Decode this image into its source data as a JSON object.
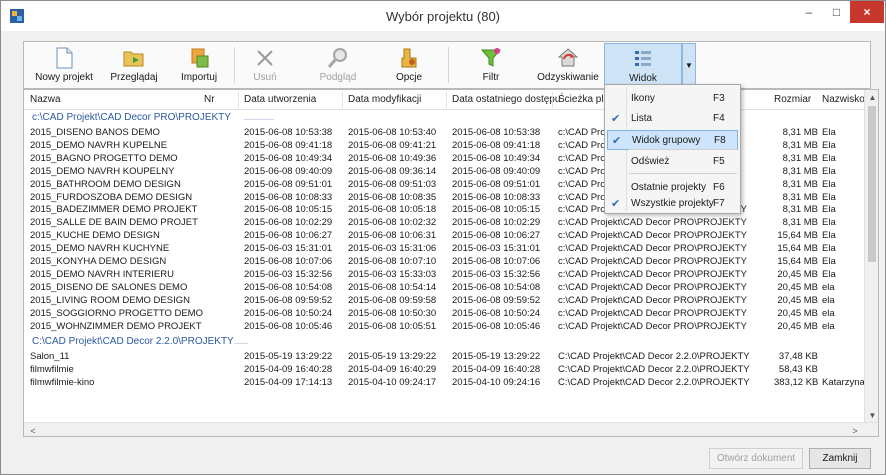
{
  "window": {
    "title": "Wybór projektu (80)",
    "minimize": "–",
    "maximize": "□",
    "close": "×"
  },
  "toolbar": {
    "buttons": [
      {
        "label": "Nowy projekt",
        "icon": "new-document-icon"
      },
      {
        "label": "Przeglądaj",
        "icon": "open-folder-icon"
      },
      {
        "label": "Importuj",
        "icon": "import-icon"
      },
      {
        "label": "Usuń",
        "icon": "delete-icon",
        "disabled": true
      },
      {
        "label": "Podgląd",
        "icon": "preview-icon",
        "disabled": true
      },
      {
        "label": "Opcje",
        "icon": "options-icon"
      },
      {
        "label": "Filtr",
        "icon": "filter-icon"
      },
      {
        "label": "Odzyskiwanie",
        "icon": "recovery-icon"
      },
      {
        "label": "Widok",
        "icon": "view-icon"
      }
    ],
    "dropdown_arrow": "▼"
  },
  "columns": {
    "name": "Nazwa",
    "nr": "Nr",
    "created": "Data utworzenia",
    "modified": "Data modyfikacji",
    "accessed": "Data ostatniego dostępu",
    "path": "Ścieżka pli",
    "size": "Rozmiar",
    "surname": "Nazwisko"
  },
  "groups": [
    {
      "header": "c:\\CAD Projekt\\CAD Decor PRO\\PROJEKTY",
      "rows": [
        {
          "name": "2015_DISENO BANOS DEMO",
          "created": "2015-06-08 10:53:38",
          "modified": "2015-06-08 10:53:40",
          "accessed": "2015-06-08 10:53:38",
          "path": "c:\\CAD Pro",
          "size": "8,31 MB",
          "surname": "Ela"
        },
        {
          "name": "2015_DEMO NAVRH KUPELNE",
          "created": "2015-06-08 09:41:18",
          "modified": "2015-06-08 09:41:21",
          "accessed": "2015-06-08 09:41:18",
          "path": "c:\\CAD Pro",
          "size": "8,31 MB",
          "surname": "Ela"
        },
        {
          "name": "2015_BAGNO PROGETTO DEMO",
          "created": "2015-06-08 10:49:34",
          "modified": "2015-06-08 10:49:36",
          "accessed": "2015-06-08 10:49:34",
          "path": "c:\\CAD Pro",
          "size": "8,31 MB",
          "surname": "Ela"
        },
        {
          "name": "2015_DEMO NAVRH KOUPELNY",
          "created": "2015-06-08 09:40:09",
          "modified": "2015-06-08 09:36:14",
          "accessed": "2015-06-08 09:40:09",
          "path": "c:\\CAD Pro",
          "size": "8,31 MB",
          "surname": "Ela"
        },
        {
          "name": "2015_BATHROOM DEMO DESIGN",
          "created": "2015-06-08 09:51:01",
          "modified": "2015-06-08 09:51:03",
          "accessed": "2015-06-08 09:51:01",
          "path": "c:\\CAD Pro",
          "size": "8,31 MB",
          "surname": "Ela"
        },
        {
          "name": "2015_FURDOSZOBA DEMO DESIGN",
          "created": "2015-06-08 10:08:33",
          "modified": "2015-06-08 10:08:35",
          "accessed": "2015-06-08 10:08:33",
          "path": "c:\\CAD Pro",
          "size": "8,31 MB",
          "surname": "Ela"
        },
        {
          "name": "2015_BADEZIMMER DEMO PROJEKT",
          "created": "2015-06-08 10:05:15",
          "modified": "2015-06-08 10:05:18",
          "accessed": "2015-06-08 10:05:15",
          "path": "c:\\CAD Projekt\\CAD Decor PRO\\PROJEKTY",
          "size": "8,31 MB",
          "surname": "Ela"
        },
        {
          "name": "2015_SALLE DE BAIN DEMO PROJET",
          "created": "2015-06-08 10:02:29",
          "modified": "2015-06-08 10:02:32",
          "accessed": "2015-06-08 10:02:29",
          "path": "c:\\CAD Projekt\\CAD Decor PRO\\PROJEKTY",
          "size": "8,31 MB",
          "surname": "Ela"
        },
        {
          "name": "2015_KUCHE DEMO DESIGN",
          "created": "2015-06-08 10:06:27",
          "modified": "2015-06-08 10:06:31",
          "accessed": "2015-06-08 10:06:27",
          "path": "c:\\CAD Projekt\\CAD Decor PRO\\PROJEKTY",
          "size": "15,64 MB",
          "surname": "Ela"
        },
        {
          "name": "2015_DEMO NAVRH KUCHYNE",
          "created": "2015-06-03 15:31:01",
          "modified": "2015-06-03 15:31:06",
          "accessed": "2015-06-03 15:31:01",
          "path": "c:\\CAD Projekt\\CAD Decor PRO\\PROJEKTY",
          "size": "15,64 MB",
          "surname": "Ela"
        },
        {
          "name": "2015_KONYHA DEMO DESIGN",
          "created": "2015-06-08 10:07:06",
          "modified": "2015-06-08 10:07:10",
          "accessed": "2015-06-08 10:07:06",
          "path": "c:\\CAD Projekt\\CAD Decor PRO\\PROJEKTY",
          "size": "15,64 MB",
          "surname": "Ela"
        },
        {
          "name": "2015_DEMO NAVRH INTERIERU",
          "created": "2015-06-03 15:32:56",
          "modified": "2015-06-03 15:33:03",
          "accessed": "2015-06-03 15:32:56",
          "path": "c:\\CAD Projekt\\CAD Decor PRO\\PROJEKTY",
          "size": "20,45 MB",
          "surname": "Ela"
        },
        {
          "name": "2015_DISENO DE SALONES DEMO",
          "created": "2015-06-08 10:54:08",
          "modified": "2015-06-08 10:54:14",
          "accessed": "2015-06-08 10:54:08",
          "path": "c:\\CAD Projekt\\CAD Decor PRO\\PROJEKTY",
          "size": "20,45 MB",
          "surname": "ela"
        },
        {
          "name": "2015_LIVING ROOM DEMO DESIGN",
          "created": "2015-06-08 09:59:52",
          "modified": "2015-06-08 09:59:58",
          "accessed": "2015-06-08 09:59:52",
          "path": "c:\\CAD Projekt\\CAD Decor PRO\\PROJEKTY",
          "size": "20,45 MB",
          "surname": "ela"
        },
        {
          "name": "2015_SOGGIORNO PROGETTO DEMO",
          "created": "2015-06-08 10:50:24",
          "modified": "2015-06-08 10:50:30",
          "accessed": "2015-06-08 10:50:24",
          "path": "c:\\CAD Projekt\\CAD Decor PRO\\PROJEKTY",
          "size": "20,45 MB",
          "surname": "ela"
        },
        {
          "name": "2015_WOHNZIMMER DEMO PROJEKT",
          "created": "2015-06-08 10:05:46",
          "modified": "2015-06-08 10:05:51",
          "accessed": "2015-06-08 10:05:46",
          "path": "c:\\CAD Projekt\\CAD Decor PRO\\PROJEKTY",
          "size": "20,45 MB",
          "surname": "ela"
        }
      ]
    },
    {
      "header": "C:\\CAD Projekt\\CAD Decor 2.2.0\\PROJEKTY",
      "rows": [
        {
          "name": "Salon_11",
          "created": "2015-05-19 13:29:22",
          "modified": "2015-05-19 13:29:22",
          "accessed": "2015-05-19 13:29:22",
          "path": "C:\\CAD Projekt\\CAD Decor 2.2.0\\PROJEKTY",
          "size": "37,48 KB",
          "surname": ""
        },
        {
          "name": "filmwfilmie",
          "created": "2015-04-09 16:40:28",
          "modified": "2015-04-09 16:40:29",
          "accessed": "2015-04-09 16:40:28",
          "path": "C:\\CAD Projekt\\CAD Decor 2.2.0\\PROJEKTY",
          "size": "58,43 KB",
          "surname": ""
        },
        {
          "name": "filmwfilmie-kino",
          "created": "2015-04-09 17:14:13",
          "modified": "2015-04-10 09:24:17",
          "accessed": "2015-04-10 09:24:16",
          "path": "C:\\CAD Projekt\\CAD Decor 2.2.0\\PROJEKTY",
          "size": "383,12 KB",
          "surname": "Katarzyna"
        }
      ]
    }
  ],
  "menu": {
    "items": [
      {
        "label": "Ikony",
        "shortcut": "F3",
        "checked": false
      },
      {
        "label": "Lista",
        "shortcut": "F4",
        "checked": true
      },
      {
        "label": "Widok grupowy",
        "shortcut": "F8",
        "checked": true,
        "highlighted": true
      },
      {
        "label": "Odśwież",
        "shortcut": "F5",
        "checked": false
      },
      {
        "label": "Ostatnie projekty",
        "shortcut": "F6",
        "checked": false
      },
      {
        "label": "Wszystkie projekty",
        "shortcut": "F7",
        "checked": true
      }
    ],
    "check_glyph": "✔"
  },
  "scroll": {
    "up": "▲",
    "down": "▼",
    "left": "<",
    "right": ">"
  },
  "footer": {
    "open_label": "Otwórz dokument",
    "close_label": "Zamknij"
  },
  "colors": {
    "accent": "#2c6ebd",
    "group_text": "#2a5aa0",
    "highlight": "#cde4fa",
    "close_red": "#c7372c"
  }
}
